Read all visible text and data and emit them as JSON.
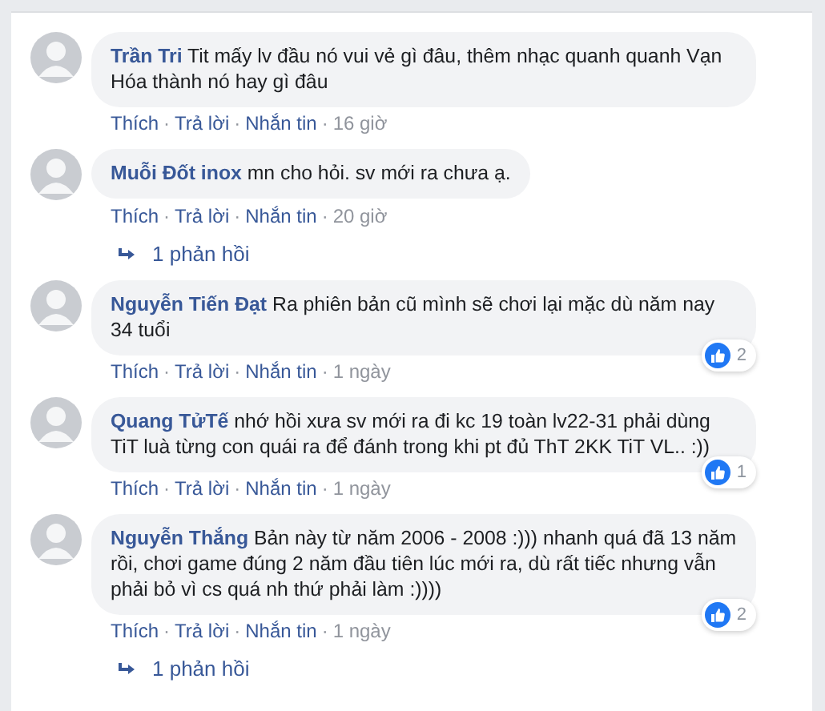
{
  "comments": [
    {
      "author": "Trần Tri",
      "text": "Tit mấy lv đầu nó vui vẻ gì đâu, thêm nhạc quanh quanh Vạn Hóa thành nó hay gì đâu",
      "meta": [
        {
          "kind": "link",
          "text": "Thích"
        },
        {
          "kind": "dot",
          "text": "·"
        },
        {
          "kind": "link",
          "text": "Trả lời"
        },
        {
          "kind": "dot",
          "text": "·"
        },
        {
          "kind": "link",
          "text": "Nhắn tin"
        },
        {
          "kind": "dot",
          "text": "·"
        },
        {
          "kind": "time",
          "text": "16 giờ"
        }
      ]
    },
    {
      "author": "Muỗi Đốt inox",
      "text": "mn cho hỏi. sv mới ra chưa ạ.",
      "meta": [
        {
          "kind": "link",
          "text": "Thích"
        },
        {
          "kind": "dot",
          "text": "·"
        },
        {
          "kind": "link",
          "text": "Trả lời"
        },
        {
          "kind": "dot",
          "text": "·"
        },
        {
          "kind": "link",
          "text": "Nhắn tin"
        },
        {
          "kind": "dot",
          "text": "·"
        },
        {
          "kind": "time",
          "text": "20 giờ"
        }
      ],
      "replies": "1 phản hồi"
    },
    {
      "author": "Nguyễn Tiến Đạt",
      "text": "Ra phiên bản cũ mình sẽ chơi lại mặc dù năm nay 34 tuổi",
      "meta": [
        {
          "kind": "link",
          "text": "Thích"
        },
        {
          "kind": "dot",
          "text": "·"
        },
        {
          "kind": "link",
          "text": "Trả lời"
        },
        {
          "kind": "dot",
          "text": "·"
        },
        {
          "kind": "link",
          "text": "Nhắn tin"
        },
        {
          "kind": "dot",
          "text": "·"
        },
        {
          "kind": "time",
          "text": "1 ngày"
        }
      ],
      "likes": "2"
    },
    {
      "author": "Quang TửTế",
      "text": "nhớ hồi xưa sv mới ra đi kc 19 toàn lv22-31 phải dùng TiT luà từng con quái ra để đánh trong khi pt đủ ThT 2KK TiT VL.. :))",
      "meta": [
        {
          "kind": "link",
          "text": "Thích"
        },
        {
          "kind": "dot",
          "text": "·"
        },
        {
          "kind": "link",
          "text": "Trả lời"
        },
        {
          "kind": "dot",
          "text": "·"
        },
        {
          "kind": "link",
          "text": "Nhắn tin"
        },
        {
          "kind": "dot",
          "text": "·"
        },
        {
          "kind": "time",
          "text": "1 ngày"
        }
      ],
      "likes": "1"
    },
    {
      "author": "Nguyễn Thắng",
      "text": "Bản này từ năm 2006 - 2008 :))) nhanh quá đã 13 năm rồi, chơi game đúng 2 năm đầu tiên lúc mới ra, dù rất tiếc nhưng vẫn phải bỏ vì cs quá nh thứ phải làm :))))",
      "meta": [
        {
          "kind": "link",
          "text": "Thích"
        },
        {
          "kind": "dot",
          "text": "·"
        },
        {
          "kind": "link",
          "text": "Trả lời"
        },
        {
          "kind": "dot",
          "text": "·"
        },
        {
          "kind": "link",
          "text": "Nhắn tin"
        },
        {
          "kind": "dot",
          "text": "·"
        },
        {
          "kind": "time",
          "text": "1 ngày"
        }
      ],
      "likes": "2",
      "replies": "1 phản hồi"
    }
  ]
}
